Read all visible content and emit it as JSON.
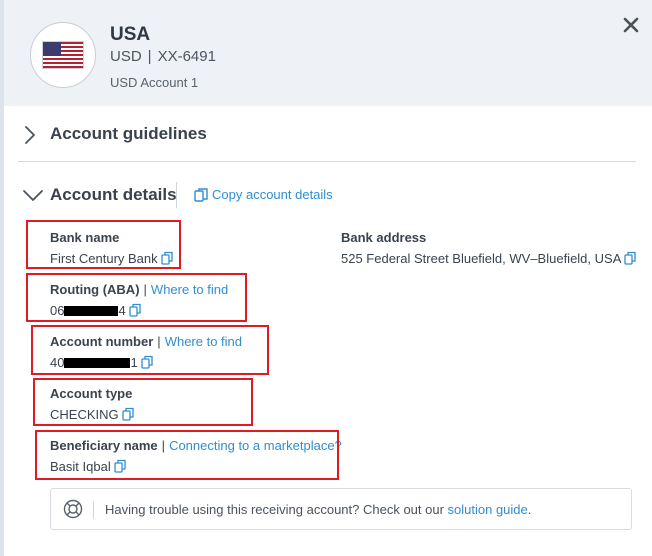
{
  "header": {
    "country": "USA",
    "currency": "USD",
    "separator": "|",
    "account_masked": "XX-6491",
    "account_label": "USD Account 1",
    "flag_icon": "us-flag-icon"
  },
  "sections": {
    "guidelines_title": "Account guidelines",
    "details_title": "Account details",
    "copy_details_label": "Copy account details"
  },
  "fields": {
    "bank_name": {
      "label": "Bank name",
      "value": "First Century Bank"
    },
    "bank_address": {
      "label": "Bank address",
      "value": "525 Federal Street Bluefield, WV–Bluefield, USA"
    },
    "routing": {
      "label": "Routing (ABA)",
      "link": "Where to find",
      "value_prefix": "06",
      "value_suffix": "4"
    },
    "account_number": {
      "label": "Account number",
      "link": "Where to find",
      "value_prefix": "40",
      "value_suffix": "1"
    },
    "account_type": {
      "label": "Account type",
      "value": "CHECKING"
    },
    "beneficiary": {
      "label": "Beneficiary name",
      "link": "Connecting to a marketplace?",
      "value": "Basit Iqbal"
    }
  },
  "notice": {
    "text": "Having trouble using this receiving account? Check out our ",
    "link": "solution guide",
    "end": "."
  },
  "colors": {
    "accent": "#2f8fd1",
    "highlight": "#e01b24",
    "header_bg": "#eef1f5"
  }
}
